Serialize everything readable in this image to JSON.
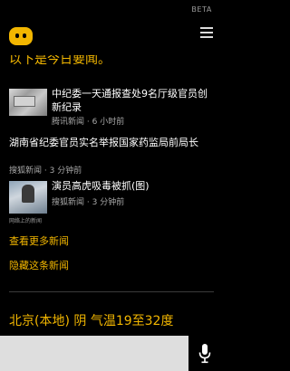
{
  "header": {
    "beta_label": "BETA",
    "logo_icon": "cortana-face-icon",
    "menu_icon": "hamburger-menu-icon"
  },
  "section_heading": "以下是今日要闻。",
  "news": [
    {
      "title": "中纪委一天通报查处9名厅级官员创新纪录",
      "source": "腾讯新闻",
      "time": "6 小时前",
      "has_thumbnail": true
    },
    {
      "title": "湖南省纪委官员实名举报国家药监局前局长",
      "source": "搜狐新闻",
      "time": "3 分钟前",
      "has_thumbnail": false
    },
    {
      "title": "演员高虎吸毒被抓(图)",
      "source": "搜狐新闻",
      "time": "3 分钟前",
      "has_thumbnail": true,
      "thumbnail_caption": "网络上的新闻"
    }
  ],
  "links": {
    "more_news": "查看更多新闻",
    "hide_news": "隐藏这条新闻"
  },
  "weather": {
    "text": "北京(本地) 阴 气温19至32度"
  },
  "search": {
    "value": "",
    "placeholder": "",
    "mic_icon": "microphone-icon"
  },
  "colors": {
    "accent": "#f2b600",
    "background": "#000000",
    "meta_text": "#a8a8a8",
    "search_bg": "#dedede"
  }
}
